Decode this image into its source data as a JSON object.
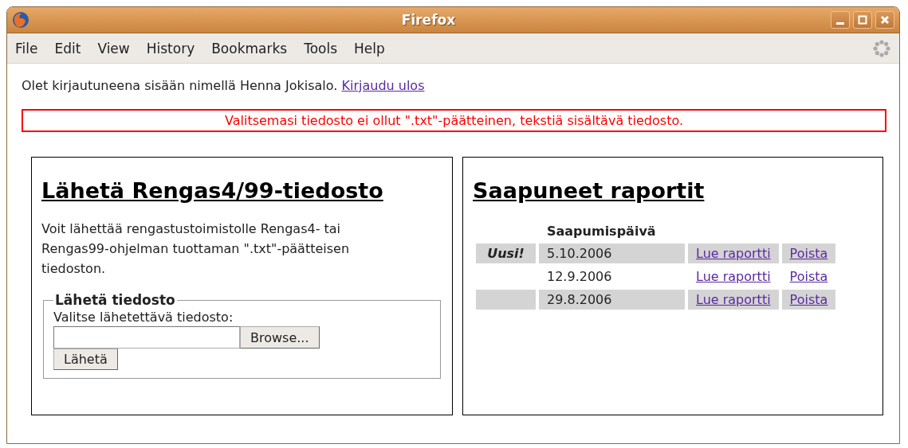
{
  "window": {
    "title": "Firefox"
  },
  "menu": [
    "File",
    "Edit",
    "View",
    "History",
    "Bookmarks",
    "Tools",
    "Help"
  ],
  "login": {
    "text": "Olet kirjautuneena sisään nimellä Henna Jokisalo.",
    "link": "Kirjaudu ulos"
  },
  "error": "Valitsemasi tiedosto ei ollut \".txt\"-päätteinen, tekstiä sisältävä tiedosto.",
  "upload": {
    "heading": "Lähetä Rengas4/99-tiedosto",
    "text": "Voit lähettää rengastustoimistolle Rengas4- tai Rengas99-ohjelman tuottaman \".txt\"-päätteisen tiedoston.",
    "legend": "Lähetä tiedosto",
    "field_label": "Valitse lähetettävä tiedosto:",
    "browse": "Browse...",
    "submit": "Lähetä"
  },
  "reports": {
    "heading": "Saapuneet raportit",
    "column": "Saapumispäivä",
    "rows": [
      {
        "badge": "Uusi!",
        "date": "5.10.2006",
        "read": "Lue raportti",
        "delete": "Poista"
      },
      {
        "date": "12.9.2006",
        "read": "Lue raportti",
        "delete": "Poista"
      },
      {
        "date": "29.8.2006",
        "read": "Lue raportti",
        "delete": "Poista"
      }
    ]
  }
}
